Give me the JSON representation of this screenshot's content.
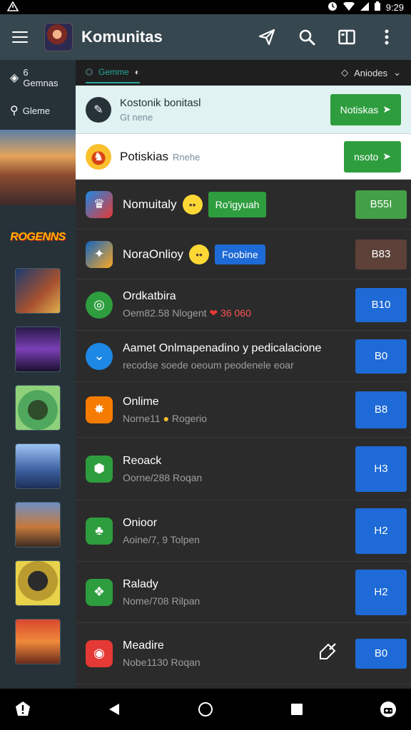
{
  "status_bar": {
    "time": "9:29"
  },
  "app_bar": {
    "title": "Komunitas"
  },
  "sidebar": {
    "nav": [
      {
        "label": "6 Gemnas"
      },
      {
        "label": "Gleme"
      }
    ],
    "logo_text": "ROGENNS"
  },
  "tabs": {
    "left": "Gemme",
    "right": "Aniodes"
  },
  "banners": [
    {
      "title": "Kostonik bonitasl",
      "subtitle": "Gt nene",
      "button": "Notiskas"
    },
    {
      "title": "Potiskias",
      "subtitle": "Rnehe",
      "button": "nsoto"
    }
  ],
  "rows": [
    {
      "title": "Nomuitaly",
      "chip": "Ro'igyuah",
      "action": "B55I"
    },
    {
      "title": "NoraOnlioy",
      "chip": "Foobine",
      "action": "B83"
    },
    {
      "title": "Ordkatbira",
      "subtitle": "Oem82.58 Nlogent",
      "count": "36 060",
      "action": "B10"
    },
    {
      "title": "Aamet Onlmapenadino y pedicalacione",
      "subtitle": "recodse soede oeoum peodenele eoar",
      "action": "B0"
    },
    {
      "title": "Onlime",
      "subtitle": "Norne11",
      "subtitle2": "Rogerio",
      "action": "B8"
    },
    {
      "title": "Reoack",
      "subtitle": "Oorne/288 Roqan",
      "action": "H3"
    },
    {
      "title": "Onioor",
      "subtitle": "Aoine/7, 9 Tolpen",
      "action": "H2"
    },
    {
      "title": "Ralady",
      "subtitle": "Nome/708 Rilpan",
      "action": "H2"
    },
    {
      "title": "Meadire",
      "subtitle": "Nobe1130 Roqan",
      "action": "B0"
    }
  ],
  "colors": {
    "app_bar": "#37474f",
    "sidebar": "#263238",
    "green_action": "#2e9d3e",
    "bright_green": "#43a047",
    "blue_action": "#1e6ad6",
    "brown_action": "#5d4037"
  }
}
